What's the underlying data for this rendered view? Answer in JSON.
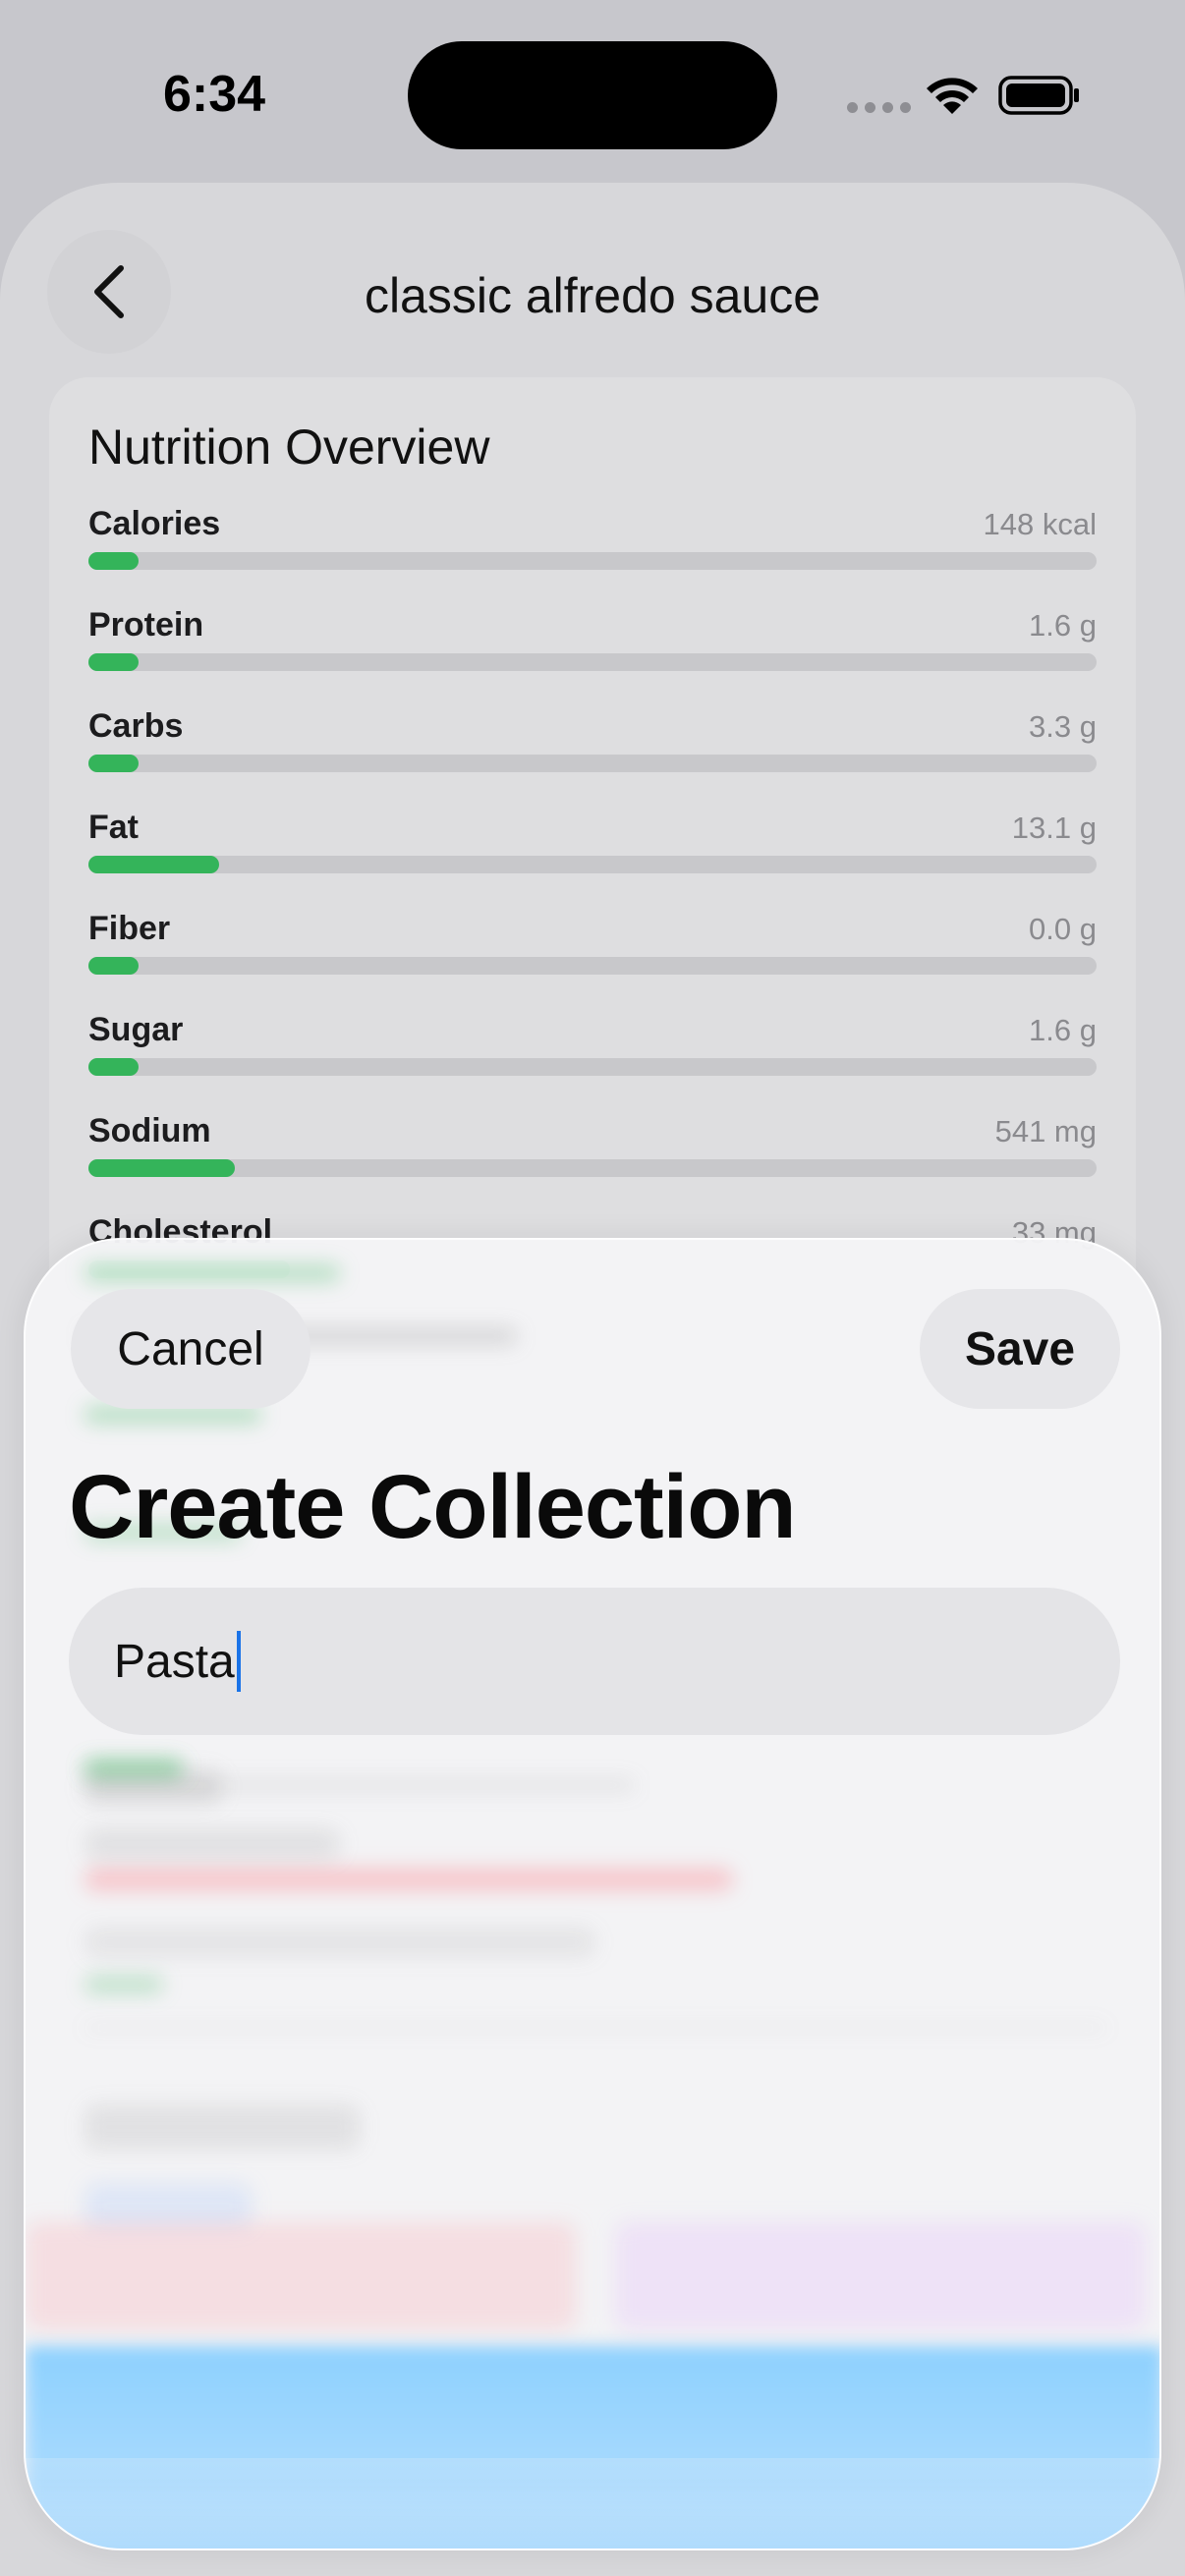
{
  "status_bar": {
    "time": "6:34"
  },
  "header": {
    "title": "classic alfredo sauce",
    "back_icon": "chevron-left-icon"
  },
  "nutrition": {
    "title": "Nutrition Overview",
    "items": [
      {
        "label": "Calories",
        "value": "148 kcal",
        "fill": 0.05
      },
      {
        "label": "Protein",
        "value": "1.6 g",
        "fill": 0.05
      },
      {
        "label": "Carbs",
        "value": "3.3 g",
        "fill": 0.05
      },
      {
        "label": "Fat",
        "value": "13.1 g",
        "fill": 0.13
      },
      {
        "label": "Fiber",
        "value": "0.0 g",
        "fill": 0.05
      },
      {
        "label": "Sugar",
        "value": "1.6 g",
        "fill": 0.05
      },
      {
        "label": "Sodium",
        "value": "541 mg",
        "fill": 0.145
      },
      {
        "label": "Cholesterol",
        "value": "33 mg",
        "fill": 0.2
      }
    ],
    "bar_color": "#34b45a"
  },
  "sheet": {
    "cancel_label": "Cancel",
    "save_label": "Save",
    "title": "Create Collection",
    "name_value": "Pasta"
  }
}
